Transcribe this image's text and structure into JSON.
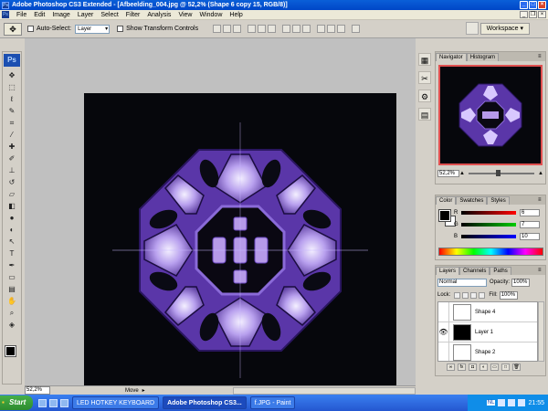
{
  "window": {
    "title": "Adobe Photoshop CS3 Extended - [Afbeelding_004.jpg @ 52,2% (Shape 6 copy 15, RGB/8)]"
  },
  "menu": [
    "File",
    "Edit",
    "Image",
    "Layer",
    "Select",
    "Filter",
    "Analysis",
    "View",
    "Window",
    "Help"
  ],
  "options": {
    "auto_select_label": "Auto-Select:",
    "auto_select_value": "Layer",
    "show_transform_label": "Show Transform Controls",
    "workspace_label": "Workspace ▾"
  },
  "toolbox": {
    "logo": "Ps"
  },
  "status": {
    "zoom": "52,2%",
    "mode": "Move"
  },
  "navigator": {
    "tabs": [
      "Navigator",
      "Histogram"
    ],
    "zoom": "52,2%"
  },
  "color_panel": {
    "tabs": [
      "Color",
      "Swatches",
      "Styles"
    ],
    "channels": [
      {
        "name": "R",
        "value": "6",
        "color": "#c81414"
      },
      {
        "name": "G",
        "value": "7",
        "color": "#14a014"
      },
      {
        "name": "B",
        "value": "10",
        "color": "#1428c8"
      }
    ]
  },
  "layers_panel": {
    "tabs": [
      "Layers",
      "Channels",
      "Paths"
    ],
    "blend_mode": "Normal",
    "opacity_label": "Opacity:",
    "opacity": "100%",
    "lock_label": "Lock:",
    "fill_label": "Fill:",
    "fill": "100%",
    "layers": [
      {
        "name": "Shape 4",
        "visible": false,
        "thumb": "#ffffff"
      },
      {
        "name": "Layer 1",
        "visible": true,
        "thumb": "#000000"
      },
      {
        "name": "Shape 2",
        "visible": false,
        "thumb": "#ffffff"
      }
    ]
  },
  "taskbar": {
    "start": "Start",
    "tasks": [
      "LED HOTKEY KEYBOARD",
      "Adobe Photoshop CS3...",
      "f.JPG - Paint"
    ],
    "lang": "NL",
    "clock": "21:55"
  }
}
